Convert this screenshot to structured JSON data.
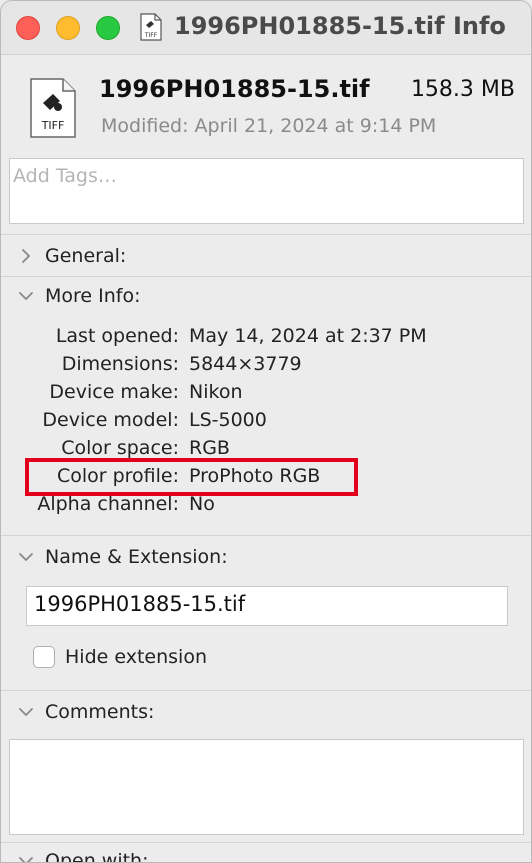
{
  "window": {
    "title": "1996PH01885-15.tif Info"
  },
  "file": {
    "icon_text": "TIFF",
    "name": "1996PH01885-15.tif",
    "size": "158.3 MB",
    "modified": "Modified: April 21, 2024 at 9:14 PM"
  },
  "tags": {
    "placeholder": "Add Tags…"
  },
  "sections": {
    "general": "General:",
    "more_info": "More Info:",
    "name_extension": "Name & Extension:",
    "comments": "Comments:",
    "open_with": "Open with:"
  },
  "more_info": {
    "rows": [
      {
        "key": "Last opened:",
        "value": "May 14, 2024 at 2:37 PM"
      },
      {
        "key": "Dimensions:",
        "value": "5844×3779"
      },
      {
        "key": "Device make:",
        "value": "Nikon"
      },
      {
        "key": "Device model:",
        "value": "LS-5000"
      },
      {
        "key": "Color space:",
        "value": "RGB"
      },
      {
        "key": "Color profile:",
        "value": "ProPhoto RGB"
      },
      {
        "key": "Alpha channel:",
        "value": "No"
      }
    ]
  },
  "name_extension": {
    "filename": "1996PH01885-15.tif",
    "hide_extension_label": "Hide extension",
    "hide_extension_checked": false
  },
  "colors": {
    "highlight": "#e3001b",
    "close": "#fe5f57",
    "minimize": "#febc2e",
    "zoom": "#28c840"
  }
}
